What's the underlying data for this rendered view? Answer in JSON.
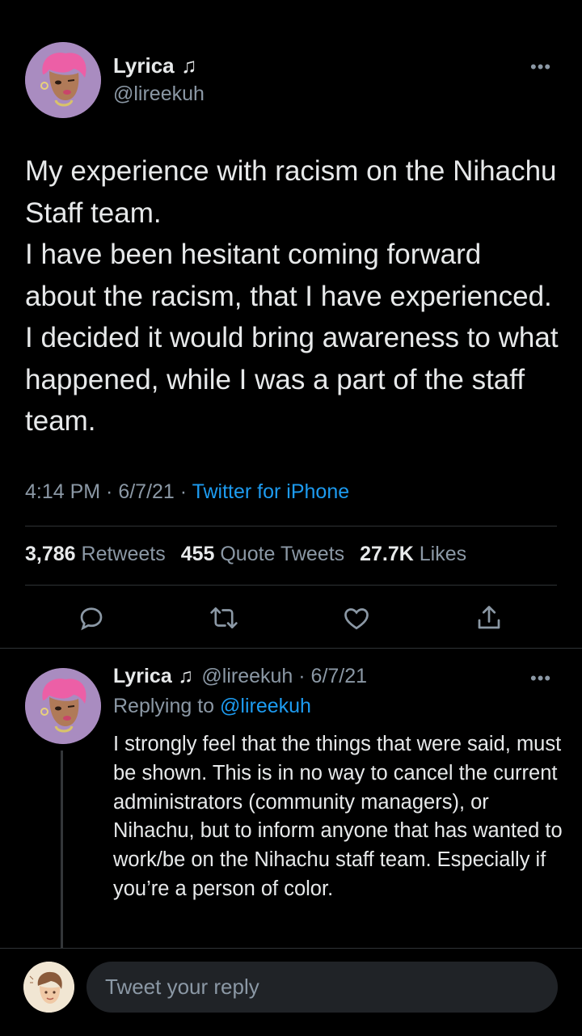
{
  "tweet": {
    "author_name": "Lyrica",
    "author_symbol": "♫",
    "author_handle": "@lireekuh",
    "more_label": "•••",
    "paragraphs": [
      "My experience with racism on the Nihachu Staff team.",
      "I have been hesitant coming forward about the racism, that I have experienced. I decided it would bring awareness to what happened, while I was a part of the staff team."
    ],
    "time": "4:14 PM",
    "date": "6/7/21",
    "separator": " · ",
    "source": "Twitter for iPhone",
    "stats": {
      "retweets_count": "3,786",
      "retweets_label": "Retweets",
      "quotes_count": "455",
      "quotes_label": "Quote Tweets",
      "likes_count": "27.7K",
      "likes_label": "Likes"
    },
    "actions": [
      "reply-icon",
      "retweet-icon",
      "like-icon",
      "share-icon"
    ]
  },
  "reply": {
    "author_name": "Lyrica",
    "author_symbol": "♫",
    "handle_and_date": "@lireekuh · 6/7/21",
    "replying_prefix": "Replying to",
    "replying_to": "@lireekuh",
    "more_label": "•••",
    "text": "I strongly feel that the things that were said, must be shown. This is in no way to cancel the current administrators (community managers), or Nihachu, but to inform anyone that has wanted to work/be on the Nihachu staff team. Especially if you’re a person of color."
  },
  "composer": {
    "placeholder": "Tweet your reply"
  },
  "colors": {
    "background": "#000000",
    "text": "#e7e9ea",
    "secondary": "#8b98a5",
    "accent": "#1d9bf0",
    "divider": "#2f3336"
  }
}
